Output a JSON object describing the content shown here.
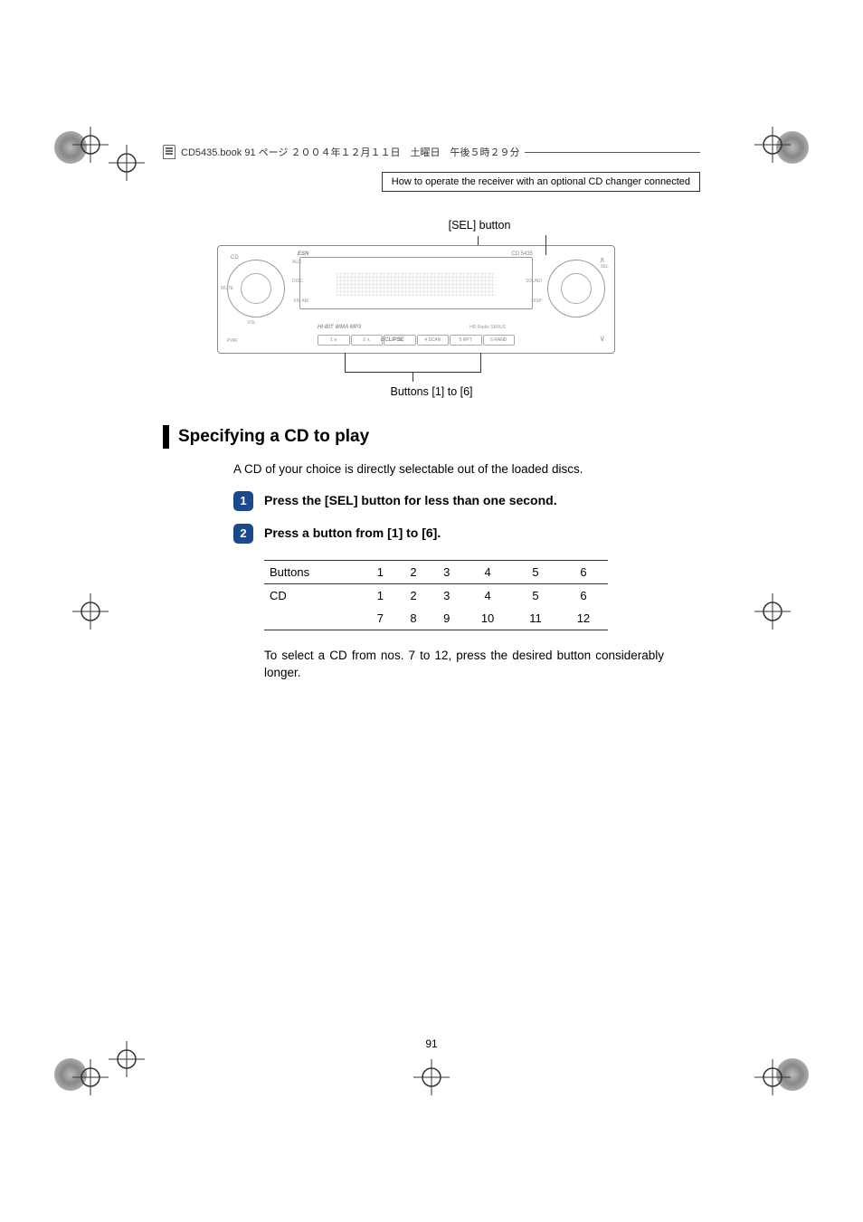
{
  "page_header": "CD5435.book  91 ページ  ２００４年１２月１１日　土曜日　午後５時２９分",
  "section_header": "How to operate the receiver with an optional CD changer connected",
  "callout_top": "[SEL] button",
  "callout_bottom": "Buttons [1] to [6]",
  "section_title": "Specifying a CD to play",
  "intro_text": "A CD of your choice is directly selectable out of the loaded discs.",
  "steps": [
    {
      "num": "1",
      "text": "Press the [SEL] button for less than one second."
    },
    {
      "num": "2",
      "text": "Press a button from [1] to [6]."
    }
  ],
  "table": {
    "header": [
      "Buttons",
      "1",
      "2",
      "3",
      "4",
      "5",
      "6"
    ],
    "row1": [
      "CD",
      "1",
      "2",
      "3",
      "4",
      "5",
      "6"
    ],
    "row2": [
      "",
      "7",
      "8",
      "9",
      "10",
      "11",
      "12"
    ]
  },
  "note": "To select a CD from nos. 7 to 12, press the desired button considerably longer.",
  "page_number": "91",
  "device": {
    "brand": "ESN",
    "model": "CD 5435",
    "labels": {
      "cd": "CD",
      "vol": "VOL",
      "mute": "MUTE",
      "disc": "DISC",
      "fm": "FM\nAM",
      "aux": "AUX",
      "pwr": "PWR",
      "sel": "SEL",
      "sound": "SOUND",
      "disp": "DISP",
      "hdradio": "HD Radio  SIRIUS",
      "eclipse": "ECLIPSE",
      "wma": "HI-BIT WMA MP3"
    },
    "buttons": [
      "1 ∨",
      "2 ∧",
      "3",
      "4 SCAN",
      "5 RPT",
      "6 RAND"
    ]
  }
}
